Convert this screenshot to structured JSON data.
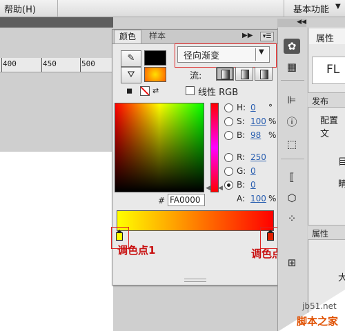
{
  "menubar": {
    "help": "帮助(H)",
    "workspace": "基本功能"
  },
  "ruler": {
    "ticks": [
      "400",
      "450",
      "500"
    ]
  },
  "color_panel": {
    "tabs": [
      "颜色",
      "样本"
    ],
    "fill_type": "径向渐变",
    "flow_label": "流:",
    "linear_rgb_label": "线性 RGB",
    "channels": {
      "h": {
        "label": "H:",
        "value": "0",
        "unit": "°"
      },
      "s": {
        "label": "S:",
        "value": "100",
        "unit": "%"
      },
      "b": {
        "label": "B:",
        "value": "98",
        "unit": "%"
      },
      "r": {
        "label": "R:",
        "value": "250"
      },
      "g": {
        "label": "G:",
        "value": "0"
      },
      "bl": {
        "label": "B:",
        "value": "0"
      },
      "a": {
        "label": "A:",
        "value": "100",
        "unit": "%"
      }
    },
    "hex_prefix": "#",
    "hex": "FA0000",
    "gradient_stops": [
      {
        "color": "#ffff00",
        "position": 0
      },
      {
        "color": "#e02000",
        "position": 1
      }
    ]
  },
  "annotations": {
    "stop1": "调色点1",
    "stop2": "调色点2"
  },
  "properties": {
    "tab": "属性",
    "logo": "FL",
    "section1": "发布",
    "config": "配置文",
    "cut1": "目",
    "cut2": "睛",
    "section2": "属性",
    "cut3": "大"
  },
  "watermark": {
    "url": "jb51.net",
    "name": "脚本之家"
  },
  "colors": {
    "accent_red": "#d22222",
    "link_blue": "#2a5fb0"
  }
}
